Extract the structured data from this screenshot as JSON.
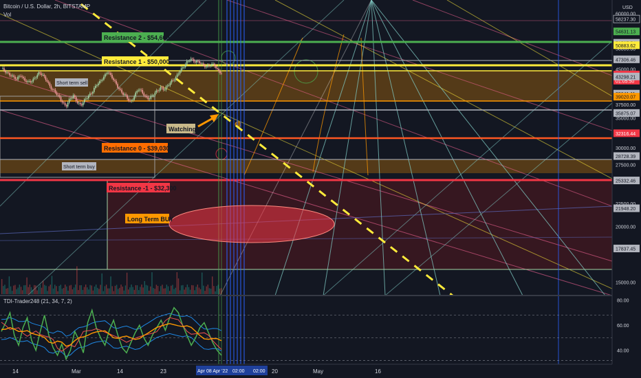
{
  "header": {
    "symbol_title": "Bitcoin / U.S. Dollar, 2h, BITSTAMP",
    "volume_label": "Vol",
    "currency": "USD"
  },
  "indicator": {
    "title": "TDI-Trader248 (21, 34, 7, 2)",
    "ticks": [
      "80.00",
      "60.00",
      "40.00"
    ],
    "tick_values": [
      80,
      60,
      40
    ]
  },
  "price_axis": {
    "ticks": [
      {
        "label": "60000.00",
        "value": 60000
      },
      {
        "label": "58237.30",
        "value": 58237.3,
        "boxed": true
      },
      {
        "label": "55000.00",
        "value": 55000
      },
      {
        "label": "50000.00",
        "value": 50000
      },
      {
        "label": "45000.00",
        "value": 45000
      },
      {
        "label": "40000.00",
        "value": 40000
      },
      {
        "label": "37500.00",
        "value": 37500
      },
      {
        "label": "35000.00",
        "value": 35000
      },
      {
        "label": "30000.00",
        "value": 30000
      },
      {
        "label": "27500.00",
        "value": 27500
      },
      {
        "label": "22500.00",
        "value": 22500
      },
      {
        "label": "20000.00",
        "value": 20000
      },
      {
        "label": "15000.00",
        "value": 15000
      }
    ],
    "badges": [
      {
        "label": "54631.13",
        "value": 54631.13,
        "color": "#4caf50",
        "text_color": "#131722"
      },
      {
        "label": "51527.54",
        "value": 51527.54,
        "color": "#b2b5be",
        "text_color": "#131722"
      },
      {
        "label": "50883.62",
        "value": 50883.62,
        "color": "#ffeb3b",
        "text_color": "#131722"
      },
      {
        "label": "47306.46",
        "value": 47306.46,
        "color": "#b2b5be",
        "text_color": "#131722"
      },
      {
        "label": "43749.59",
        "value": 43749.59,
        "color": "#f23645",
        "text_color": "#ffffff",
        "sub_label": "01:05:50"
      },
      {
        "label": "43298.21",
        "value": 43298.21,
        "color": "#b2b5be",
        "text_color": "#131722"
      },
      {
        "label": "39641.11",
        "value": 39641.11,
        "color": "#b2b5be",
        "text_color": "#131722"
      },
      {
        "label": "39020.07",
        "value": 39020.07,
        "color": "#ff9800",
        "text_color": "#131722"
      },
      {
        "label": "35875.07",
        "value": 35875.07,
        "color": "#b2b5be",
        "text_color": "#131722"
      },
      {
        "label": "32316.44",
        "value": 32316.44,
        "color": "#f23645",
        "text_color": "#ffffff"
      },
      {
        "label": "28728.39",
        "value": 28728.39,
        "color": "#b2b5be",
        "text_color": "#131722"
      },
      {
        "label": "25332.46",
        "value": 25332.46,
        "color": "#b2b5be",
        "text_color": "#131722"
      },
      {
        "label": "21948.20",
        "value": 21948.2,
        "color": "#b2b5be",
        "text_color": "#131722"
      },
      {
        "label": "17837.45",
        "value": 17837.45,
        "color": "#b2b5be",
        "text_color": "#131722"
      }
    ]
  },
  "time_axis": {
    "ticks": [
      "14",
      "Mar",
      "14",
      "23",
      "20",
      "May",
      "16"
    ],
    "crosshair_labels": [
      "Apr",
      "08 Apr '22",
      "02:00",
      "02:00"
    ]
  },
  "annotations": {
    "resistance_2": "Resistance 2 -  $54,600",
    "resistance_1": "Resistance 1 -  $50,000",
    "resistance_0": "Resistance 0 -  $39,030",
    "resistance_m1": "Resistance -1 -  $32,300",
    "short_term_sell": "Short term sell",
    "short_term_buy": "Short term buy",
    "watching": "Watching",
    "long_term_buy": "Long Term BUY"
  },
  "colors": {
    "background": "#131722",
    "resistance_2": "#4caf50",
    "resistance_1": "#ffeb3b",
    "resistance_0": "#ff9800",
    "resistance_m1": "#f23645",
    "candle_up": "#a5d6a7",
    "candle_down": "#ef9a9a",
    "trendline": "#ffeb3b",
    "crosshair_band": "#2962ff"
  },
  "chart_data": {
    "type": "candlestick",
    "title": "Bitcoin / U.S. Dollar, 2h, BITSTAMP",
    "y_scale": "log",
    "ylim": [
      14500,
      62000
    ],
    "x_tick_labels": [
      "14",
      "Mar",
      "14",
      "23",
      "20",
      "May",
      "16"
    ],
    "price_path": [
      45000,
      44500,
      44000,
      43200,
      42500,
      43800,
      42700,
      41900,
      42200,
      43400,
      44200,
      43300,
      42400,
      41000,
      40000,
      39000,
      38200,
      37200,
      38300,
      39200,
      38100,
      37300,
      38200,
      39300,
      40200,
      41300,
      42000,
      43400,
      44500,
      43100,
      42000,
      40800,
      39600,
      38800,
      38000,
      39200,
      40400,
      40000,
      39100,
      38700,
      39200,
      40200,
      41100,
      40400,
      41300,
      42500,
      43200,
      44400,
      45400,
      47000,
      47400,
      46500,
      46800,
      46200,
      45400,
      45800,
      46300,
      44800,
      43800
    ],
    "levels": [
      {
        "name": "Resistance 2",
        "value": 54600
      },
      {
        "name": "Resistance 1",
        "value": 50000
      },
      {
        "name": "Resistance 0",
        "value": 39030
      },
      {
        "name": "Resistance -1",
        "value": 32300
      }
    ],
    "zones": [
      {
        "name": "Short term sell",
        "from": 45000,
        "to": 50000
      },
      {
        "name": "Short term buy",
        "from": 33300,
        "to": 35800
      },
      {
        "name": "Long Term BUY",
        "from": 17837.45,
        "to": 32316.44
      }
    ],
    "current_price": 43749.59,
    "countdown": "01:05:50",
    "indicator": {
      "name": "TDI-Trader248",
      "params": [
        21,
        34,
        7,
        2
      ],
      "ylim": [
        30,
        82
      ],
      "levels": [
        68,
        50,
        32
      ],
      "rsi_path": [
        55,
        62,
        70,
        52,
        44,
        58,
        66,
        48,
        40,
        55,
        68,
        52,
        42,
        36,
        45,
        33,
        40,
        55,
        48,
        38,
        62,
        72,
        58,
        50,
        44,
        56,
        64,
        52,
        42,
        38,
        46,
        54,
        60,
        50,
        44,
        52,
        58,
        64,
        56,
        66,
        74,
        70,
        60,
        52,
        44,
        50,
        58,
        62,
        54,
        46,
        40,
        36
      ]
    }
  }
}
